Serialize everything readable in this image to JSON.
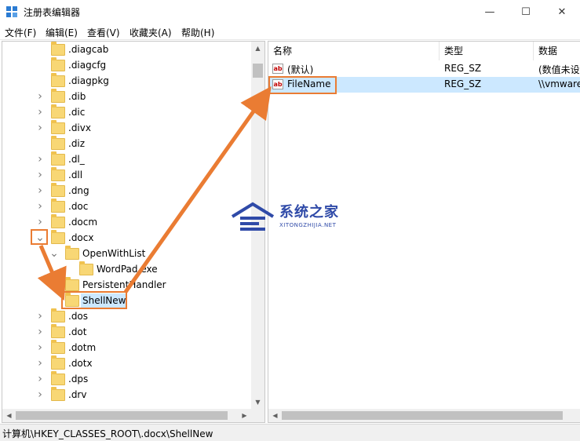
{
  "window": {
    "title": "注册表编辑器",
    "controls": {
      "minimize": "—",
      "maximize": "☐",
      "close": "✕"
    }
  },
  "menu": [
    "文件(F)",
    "编辑(E)",
    "查看(V)",
    "收藏夹(A)",
    "帮助(H)"
  ],
  "tree": [
    {
      "label": ".diagcab",
      "chevron": ""
    },
    {
      "label": ".diagcfg",
      "chevron": ""
    },
    {
      "label": ".diagpkg",
      "chevron": ""
    },
    {
      "label": ".dib",
      "chevron": ">"
    },
    {
      "label": ".dic",
      "chevron": ">"
    },
    {
      "label": ".divx",
      "chevron": ">"
    },
    {
      "label": ".diz",
      "chevron": ""
    },
    {
      "label": ".dl_",
      "chevron": ">"
    },
    {
      "label": ".dll",
      "chevron": ">"
    },
    {
      "label": ".dng",
      "chevron": ">"
    },
    {
      "label": ".doc",
      "chevron": ">"
    },
    {
      "label": ".docm",
      "chevron": ">"
    },
    {
      "label": ".docx",
      "chevron": "v"
    },
    {
      "label": "OpenWithList",
      "chevron": "v"
    },
    {
      "label": "WordPad.exe",
      "chevron": ""
    },
    {
      "label": "PersistentHandler",
      "chevron": ""
    },
    {
      "label": "ShellNew",
      "chevron": ""
    },
    {
      "label": ".dos",
      "chevron": ">"
    },
    {
      "label": ".dot",
      "chevron": ">"
    },
    {
      "label": ".dotm",
      "chevron": ">"
    },
    {
      "label": ".dotx",
      "chevron": ">"
    },
    {
      "label": ".dps",
      "chevron": ">"
    },
    {
      "label": ".drv",
      "chevron": ">"
    }
  ],
  "columns": {
    "name": "名称",
    "type": "类型",
    "data": "数据"
  },
  "values": [
    {
      "name": "(默认)",
      "type": "REG_SZ",
      "data": "(数值未设",
      "icon": "ab"
    },
    {
      "name": "FileName",
      "type": "REG_SZ",
      "data": "\\\\vmware",
      "icon": "ab"
    }
  ],
  "status": "计算机\\HKEY_CLASSES_ROOT\\.docx\\ShellNew",
  "watermark": {
    "title": "系统之家",
    "subtitle": "XITONGZHIJIA.NET"
  },
  "colors": {
    "highlight": "#ea7c33",
    "selection": "#cce8ff",
    "folder": "#f8d775"
  }
}
